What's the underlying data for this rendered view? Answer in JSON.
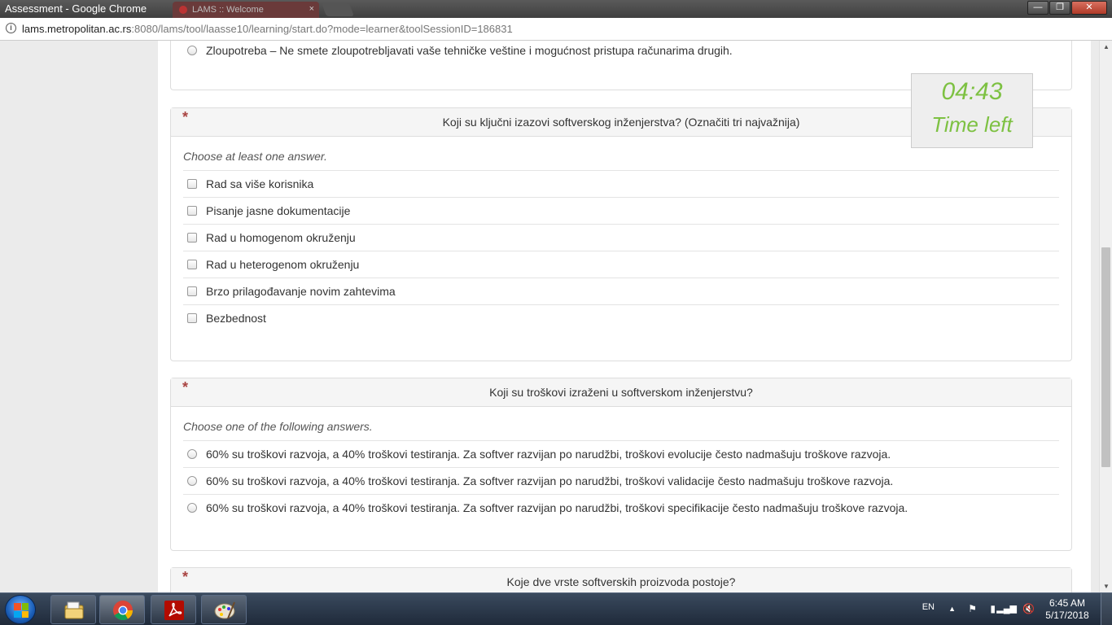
{
  "browser": {
    "window_title": "Assessment - Google Chrome",
    "background_tab_title": "LAMS :: Welcome",
    "url_host": "lams.metropolitan.ac.rs",
    "url_rest": ":8080/lams/tool/laasse10/learning/start.do?mode=learner&toolSessionID=186831",
    "min_label": "—",
    "max_label": "❐",
    "close_label": "✕"
  },
  "timer": {
    "time": "04:43",
    "label": "Time left"
  },
  "top_option": {
    "label": "Zloupotreba – Ne smete zloupotrebljavati vaše tehničke veštine i mogućnost pristupa računarima drugih."
  },
  "questions": [
    {
      "required_mark": "*",
      "title": "Koji su ključni izazovi softverskog inženjerstva? (Označiti tri najvažnija)",
      "instruction": "Choose at least one answer.",
      "options": [
        "Rad sa više korisnika",
        "Pisanje jasne dokumentacije",
        "Rad u homogenom okruženju",
        "Rad u heterogenom okruženju",
        "Brzo prilagođavanje novim zahtevima",
        "Bezbednost"
      ]
    },
    {
      "required_mark": "*",
      "title": "Koji su troškovi izraženi u softverskom inženjerstvu?",
      "instruction": "Choose one of the following answers.",
      "options": [
        "60% su troškovi razvoja, a 40% troškovi testiranja. Za softver razvijan po narudžbi, troškovi evolucije često nadmašuju troškove razvoja.",
        "60% su troškovi razvoja, a 40% troškovi testiranja. Za softver razvijan po narudžbi, troškovi validacije često nadmašuju troškove razvoja.",
        "60% su troškovi razvoja, a 40% troškovi testiranja. Za softver razvijan po narudžbi, troškovi specifikacije često nadmašuju troškove razvoja."
      ]
    },
    {
      "required_mark": "*",
      "title": "Koje dve vrste softverskih proizvoda postoje?"
    }
  ],
  "taskbar": {
    "language": "EN",
    "time": "6:45 AM",
    "date": "5/17/2018",
    "colors": {
      "chrome_red": "#db4437",
      "chrome_green": "#0f9d58",
      "chrome_yellow": "#f4b400",
      "chrome_blue": "#4285f4",
      "acrobat_red": "#b30b00"
    },
    "apps": [
      "windows-explorer-icon",
      "chrome-icon",
      "acrobat-icon",
      "paint-icon"
    ]
  }
}
